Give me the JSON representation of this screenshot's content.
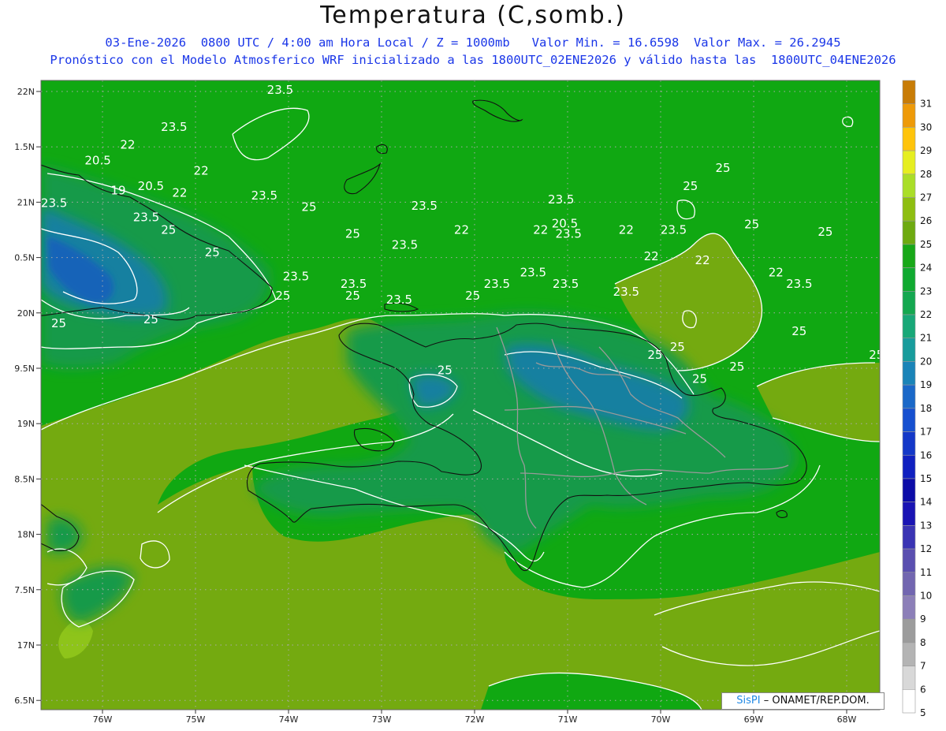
{
  "title": "Temperatura (C,somb.)",
  "subtitle1": "03-Ene-2026  0800 UTC / 4:00 am Hora Local / Z = 1000mb   Valor Min. = 16.6598  Valor Max. = 26.2945",
  "subtitle2": "Pronóstico con el Modelo Atmosferico WRF inicializado a las 1800UTC_02ENE2026 y válido hasta las  1800UTC_04ENE2026",
  "lat_labels": [
    "22N",
    "1.5N",
    "21N",
    "0.5N",
    "20N",
    "9.5N",
    "19N",
    "8.5N",
    "18N",
    "7.5N",
    "17N",
    "6.5N"
  ],
  "lon_labels": [
    "76W",
    "75W",
    "74W",
    "73W",
    "72W",
    "71W",
    "70W",
    "69W",
    "68W"
  ],
  "colorbar": {
    "values": [
      5,
      6,
      7,
      8,
      9,
      10,
      11,
      12,
      13,
      14,
      15,
      16,
      17,
      18,
      19,
      20,
      21,
      22,
      23,
      24,
      25,
      26,
      27,
      28,
      29,
      30,
      31
    ],
    "colors": [
      "#ffffff",
      "#d8d8d8",
      "#b4b4b4",
      "#9c9c9c",
      "#8c7fb8",
      "#7266b0",
      "#5a4fb0",
      "#3a34b4",
      "#1a14b4",
      "#0c0ca8",
      "#1020c0",
      "#1438c8",
      "#1650d0",
      "#1a68c8",
      "#1a84b8",
      "#189c9c",
      "#18a878",
      "#14a850",
      "#10aa30",
      "#18a818",
      "#6eaa10",
      "#8ebe10",
      "#aade28",
      "#e6ee20",
      "#ffc40a",
      "#ee9a08",
      "#c87c06"
    ]
  },
  "map_colors": {
    "water_ocean": "#10a812",
    "warm_25": "#74aa10",
    "cool_22": "#149a4a",
    "cool_20": "#1480a0",
    "cold_19": "#1864b8",
    "coast": "#111111",
    "border": "#9a9a9a",
    "grid": "#aaaaaa"
  },
  "contour_labels": [
    {
      "text": "23.5",
      "lon": -74.09,
      "lat": 21.96
    },
    {
      "text": "23.5",
      "lon": -75.23,
      "lat": 21.29
    },
    {
      "text": "22",
      "lon": -75.73,
      "lat": 20.97
    },
    {
      "text": "20.5",
      "lon": -76.05,
      "lat": 20.68
    },
    {
      "text": "22",
      "lon": -74.94,
      "lat": 20.5
    },
    {
      "text": "20.5",
      "lon": -75.48,
      "lat": 20.22
    },
    {
      "text": "19",
      "lon": -75.83,
      "lat": 20.14
    },
    {
      "text": "22",
      "lon": -75.17,
      "lat": 20.1
    },
    {
      "text": "23.5",
      "lon": -74.26,
      "lat": 20.05
    },
    {
      "text": "23.5",
      "lon": -76.52,
      "lat": 19.91
    },
    {
      "text": "25",
      "lon": -73.78,
      "lat": 19.84
    },
    {
      "text": "23.5",
      "lon": -75.53,
      "lat": 19.66
    },
    {
      "text": "25",
      "lon": -75.29,
      "lat": 19.43
    },
    {
      "text": "23.5",
      "lon": -72.54,
      "lat": 19.86
    },
    {
      "text": "23.5",
      "lon": -71.07,
      "lat": 19.98
    },
    {
      "text": "20.5",
      "lon": -71.03,
      "lat": 19.54
    },
    {
      "text": "22",
      "lon": -72.14,
      "lat": 19.43
    },
    {
      "text": "22",
      "lon": -71.29,
      "lat": 19.43
    },
    {
      "text": "23.5",
      "lon": -70.99,
      "lat": 19.36
    },
    {
      "text": "22",
      "lon": -70.37,
      "lat": 19.43
    },
    {
      "text": "23.5",
      "lon": -69.86,
      "lat": 19.43
    },
    {
      "text": "25",
      "lon": -73.31,
      "lat": 19.36
    },
    {
      "text": "23.5",
      "lon": -72.75,
      "lat": 19.16
    },
    {
      "text": "22",
      "lon": -70.1,
      "lat": 18.95
    },
    {
      "text": "22",
      "lon": -69.55,
      "lat": 18.88
    },
    {
      "text": "22",
      "lon": -68.76,
      "lat": 18.66
    },
    {
      "text": "23.5",
      "lon": -71.37,
      "lat": 18.66
    },
    {
      "text": "23.5",
      "lon": -71.02,
      "lat": 18.45
    },
    {
      "text": "23.5",
      "lon": -71.76,
      "lat": 18.45
    },
    {
      "text": "23.5",
      "lon": -68.51,
      "lat": 18.45
    },
    {
      "text": "23.5",
      "lon": -70.37,
      "lat": 18.31
    },
    {
      "text": "23.5",
      "lon": -73.92,
      "lat": 18.59
    },
    {
      "text": "23.5",
      "lon": -73.3,
      "lat": 18.45
    },
    {
      "text": "25",
      "lon": -73.31,
      "lat": 18.24
    },
    {
      "text": "23.5",
      "lon": -72.81,
      "lat": 18.17
    },
    {
      "text": "25",
      "lon": -74.06,
      "lat": 18.24
    },
    {
      "text": "25",
      "lon": -72.02,
      "lat": 18.24
    },
    {
      "text": "25",
      "lon": -74.82,
      "lat": 19.02
    },
    {
      "text": "25",
      "lon": -75.48,
      "lat": 17.81
    },
    {
      "text": "25",
      "lon": -76.47,
      "lat": 17.74
    },
    {
      "text": "25",
      "lon": -69.33,
      "lat": 20.55
    },
    {
      "text": "25",
      "lon": -69.68,
      "lat": 20.22
    },
    {
      "text": "25",
      "lon": -69.02,
      "lat": 19.53
    },
    {
      "text": "25",
      "lon": -68.23,
      "lat": 19.39
    },
    {
      "text": "25",
      "lon": -68.51,
      "lat": 17.6
    },
    {
      "text": "25",
      "lon": -69.82,
      "lat": 17.31
    },
    {
      "text": "25",
      "lon": -70.06,
      "lat": 17.17
    },
    {
      "text": "25",
      "lon": -67.68,
      "lat": 17.17
    },
    {
      "text": "25",
      "lon": -69.18,
      "lat": 16.96
    },
    {
      "text": "25",
      "lon": -69.58,
      "lat": 16.74
    },
    {
      "text": "25",
      "lon": -72.32,
      "lat": 16.89
    }
  ],
  "credit": {
    "brand": "SisPI",
    "suffix": "– ONAMET/REP.DOM."
  }
}
